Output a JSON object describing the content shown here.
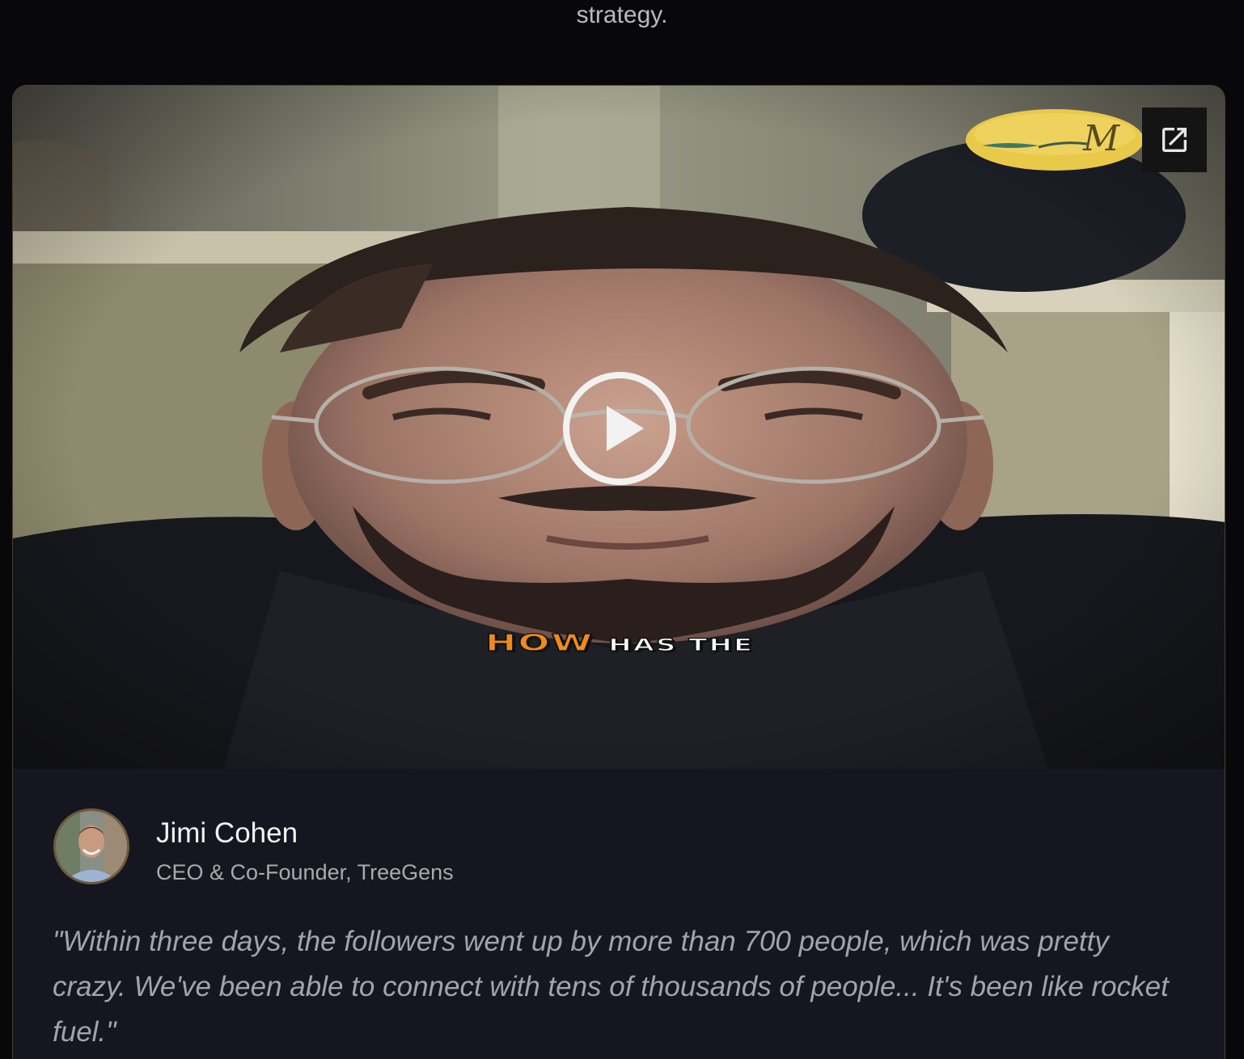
{
  "page": {
    "top_text": "strategy."
  },
  "video": {
    "caption_word_1": "HOW",
    "caption_word_2": "HAS THE",
    "logo_letter": "M",
    "play_icon": "play-circle-icon",
    "external_icon": "external-link-icon"
  },
  "testimonial": {
    "name": "Jimi Cohen",
    "role": "CEO & Co-Founder, TreeGens",
    "quote": "\"Within three days, the followers went up by more than 700 people, which was pretty crazy. We've been able to connect with tens of thousands of people... It's been like rocket fuel.\""
  },
  "colors": {
    "background": "#08080a",
    "card_bg": "#161620",
    "caption_accent": "#f08a1c",
    "logo_gold": "#e8c94a"
  }
}
